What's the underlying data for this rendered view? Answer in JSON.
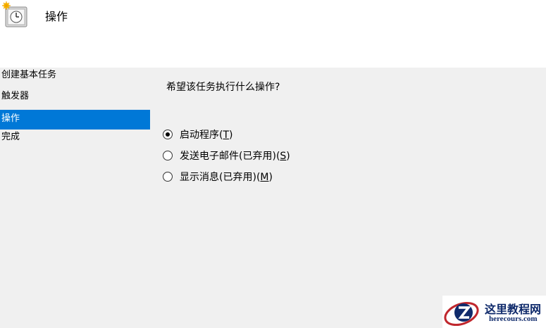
{
  "header": {
    "title": "操作",
    "icon": "task-scheduler-clock-icon"
  },
  "steps": [
    {
      "label": "创建基本任务",
      "active": false
    },
    {
      "label": "触发器",
      "active": false
    },
    {
      "label": "操作",
      "active": true
    },
    {
      "label": "完成",
      "active": false
    }
  ],
  "main": {
    "question": "希望该任务执行什么操作?",
    "options": [
      {
        "label": "启动程序",
        "mnemonic": "T",
        "checked": true
      },
      {
        "label": "发送电子邮件(已弃用)",
        "mnemonic": "S",
        "checked": false
      },
      {
        "label": "显示消息(已弃用)",
        "mnemonic": "M",
        "checked": false
      }
    ]
  },
  "watermark": {
    "name": "这里教程网",
    "url": "herecours.com"
  },
  "colors": {
    "accent": "#0078d7",
    "background": "#f0f0f0",
    "watermark_red": "#c0272d",
    "watermark_blue": "#0f2a6b"
  }
}
